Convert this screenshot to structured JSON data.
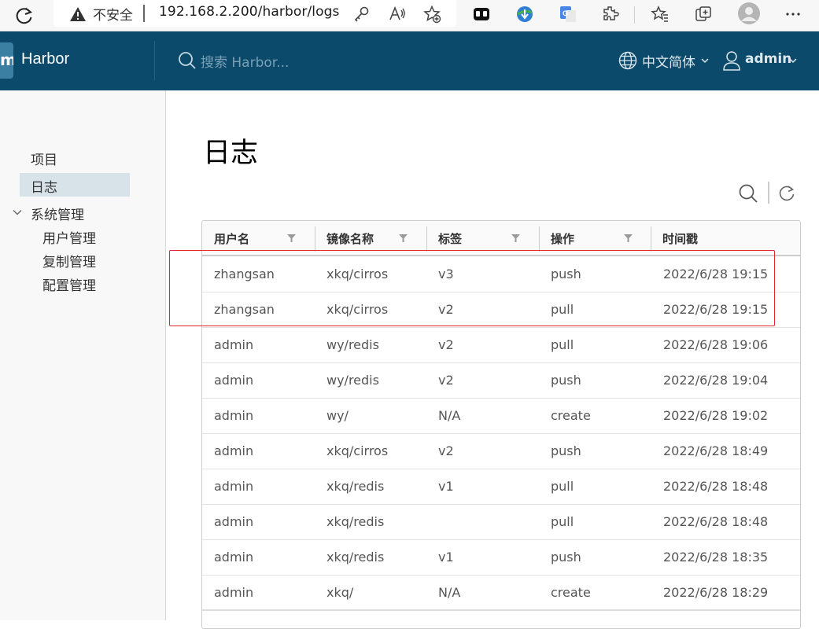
{
  "browser": {
    "security_label": "不安全",
    "url": "192.168.2.200/harbor/logs"
  },
  "header": {
    "logo_letter": "m",
    "brand": "Harbor",
    "search_placeholder": "搜索 Harbor...",
    "language": "中文简体",
    "user": "admin"
  },
  "sidebar": {
    "items": [
      {
        "label": "项目"
      },
      {
        "label": "日志"
      },
      {
        "label": "系统管理"
      },
      {
        "label": "用户管理"
      },
      {
        "label": "复制管理"
      },
      {
        "label": "配置管理"
      }
    ]
  },
  "main": {
    "title": "日志",
    "columns": [
      "用户名",
      "镜像名称",
      "标签",
      "操作",
      "时间戳"
    ],
    "rows": [
      [
        "zhangsan",
        "xkq/cirros",
        "v3",
        "push",
        "2022/6/28 19:15"
      ],
      [
        "zhangsan",
        "xkq/cirros",
        "v2",
        "pull",
        "2022/6/28 19:15"
      ],
      [
        "admin",
        "wy/redis",
        "v2",
        "pull",
        "2022/6/28 19:06"
      ],
      [
        "admin",
        "wy/redis",
        "v2",
        "push",
        "2022/6/28 19:04"
      ],
      [
        "admin",
        "wy/",
        "N/A",
        "create",
        "2022/6/28 19:02"
      ],
      [
        "admin",
        "xkq/cirros",
        "v2",
        "push",
        "2022/6/28 18:49"
      ],
      [
        "admin",
        "xkq/redis",
        "v1",
        "pull",
        "2022/6/28 18:48"
      ],
      [
        "admin",
        "xkq/redis",
        "",
        "pull",
        "2022/6/28 18:48"
      ],
      [
        "admin",
        "xkq/redis",
        "v1",
        "push",
        "2022/6/28 18:35"
      ],
      [
        "admin",
        "xkq/",
        "N/A",
        "create",
        "2022/6/28 18:29"
      ]
    ]
  },
  "colors": {
    "header_bg": "#0b4a6b",
    "active_nav_bg": "#d8e3e9",
    "highlight_box": "#e5262f"
  }
}
